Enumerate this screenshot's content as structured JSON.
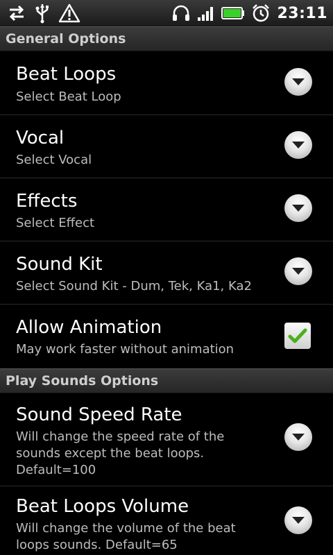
{
  "status_bar": {
    "left_icons": [
      "usb-sync-icon",
      "usb-icon",
      "warning-icon"
    ],
    "right_icons": [
      "headphones-icon",
      "signal-icon",
      "battery-icon",
      "alarm-icon"
    ],
    "time": "23:11"
  },
  "sections": {
    "general": "General Options",
    "play_sounds": "Play Sounds Options"
  },
  "prefs": {
    "beat_loops": {
      "title": "Beat Loops",
      "summary": "Select Beat Loop",
      "control": "dropdown"
    },
    "vocal": {
      "title": "Vocal",
      "summary": "Select Vocal",
      "control": "dropdown"
    },
    "effects": {
      "title": "Effects",
      "summary": "Select Effect",
      "control": "dropdown"
    },
    "sound_kit": {
      "title": "Sound Kit",
      "summary": "Select Sound Kit - Dum, Tek, Ka1, Ka2",
      "control": "dropdown"
    },
    "allow_animation": {
      "title": "Allow Animation",
      "summary": "May work faster without animation",
      "control": "checkbox",
      "checked": true
    },
    "sound_speed_rate": {
      "title": "Sound Speed Rate",
      "summary": "Will change the speed rate of the sounds except the beat loops. Default=100",
      "control": "dropdown"
    },
    "beat_loops_volume": {
      "title": "Beat Loops Volume",
      "summary": "Will change the volume of the beat loops sounds. Default=65",
      "control": "dropdown"
    }
  },
  "colors": {
    "background": "#000000",
    "check_green": "#4caf1e"
  }
}
